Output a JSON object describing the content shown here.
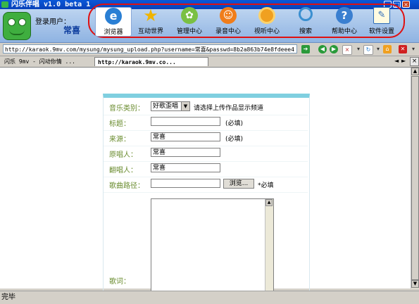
{
  "window": {
    "title": "闪乐伴唱 v1.0 beta 1"
  },
  "header": {
    "login_label": "登录用户：",
    "login_user": "常喜",
    "nav": [
      {
        "label": "浏览器",
        "icon": "browser-e-icon",
        "color": "#2a7fd4"
      },
      {
        "label": "互动世界",
        "icon": "star-icon",
        "color": "#f0b400"
      },
      {
        "label": "管理中心",
        "icon": "gear-circle-icon",
        "color": "#7ac043"
      },
      {
        "label": "录音中心",
        "icon": "smiley-icon",
        "color": "#f07d1a"
      },
      {
        "label": "视听中心",
        "icon": "disc-icon",
        "color": "#f0a020"
      },
      {
        "label": "搜索",
        "icon": "magnifier-icon",
        "color": "#3a8fd0"
      },
      {
        "label": "帮助中心",
        "icon": "help-icon",
        "color": "#3a7fd0"
      },
      {
        "label": "软件设置",
        "icon": "notepad-pen-icon",
        "color": "#2a6ab8"
      }
    ]
  },
  "address": {
    "url": "http://karaok.9mv.com/mysung/mysung_upload.php?username=常喜&passwd=8b2a863b74e8fdeee4"
  },
  "tabs": [
    {
      "label": "闪乐 9mv - 闪动你情 ..."
    },
    {
      "label": "http://karaok.9mv.co..."
    }
  ],
  "form": {
    "category_label": "音乐类别：",
    "category_value": "好歌歪唱",
    "category_hint": "请选择上传作品显示频道",
    "title_label": "标题：",
    "title_value": "",
    "title_note": "(必填)",
    "source_label": "来源：",
    "source_value": "常喜",
    "source_note": "(必填)",
    "original_label": "原唱人：",
    "original_value": "常喜",
    "cover_label": "翻唱人：",
    "cover_value": "常喜",
    "path_label": "歌曲路径：",
    "path_value": "",
    "browse_label": "浏览...",
    "path_note": "*必填",
    "lyrics_label": "歌词："
  },
  "status": {
    "text": "完毕"
  }
}
